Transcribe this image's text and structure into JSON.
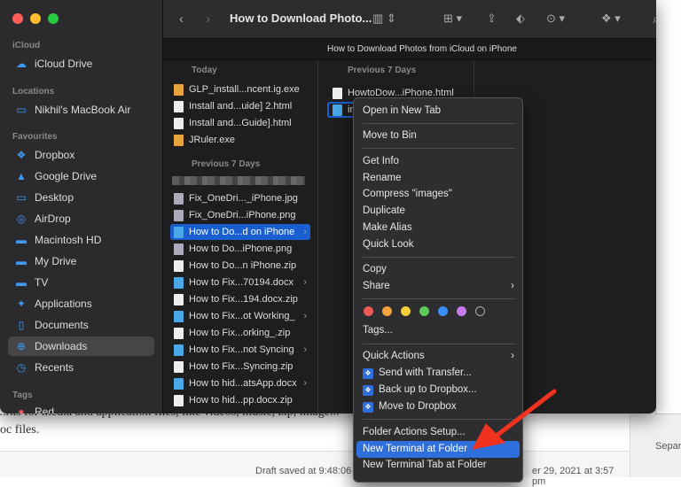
{
  "finder": {
    "title": "How to Download Photo...",
    "tab_title": "How to Download Photos from iCloud on iPhone",
    "sidebar": {
      "sections": [
        {
          "label": "iCloud",
          "items": [
            {
              "label": "iCloud Drive",
              "icon": "cloud-icon"
            }
          ]
        },
        {
          "label": "Locations",
          "items": [
            {
              "label": "Nikhil's MacBook Air",
              "icon": "laptop-icon"
            }
          ]
        },
        {
          "label": "Favourites",
          "items": [
            {
              "label": "Dropbox",
              "icon": "dropbox-icon"
            },
            {
              "label": "Google Drive",
              "icon": "google-drive-icon"
            },
            {
              "label": "Desktop",
              "icon": "desktop-icon"
            },
            {
              "label": "AirDrop",
              "icon": "airdrop-icon"
            },
            {
              "label": "Macintosh HD",
              "icon": "disk-icon"
            },
            {
              "label": "My Drive",
              "icon": "folder-icon"
            },
            {
              "label": "TV",
              "icon": "folder-icon"
            },
            {
              "label": "Applications",
              "icon": "applications-icon"
            },
            {
              "label": "Documents",
              "icon": "document-icon"
            },
            {
              "label": "Downloads",
              "icon": "download-icon",
              "selected": true
            },
            {
              "label": "Recents",
              "icon": "clock-icon"
            }
          ]
        },
        {
          "label": "Tags",
          "items": [
            {
              "label": "Red",
              "icon": "tag-red-icon"
            }
          ]
        }
      ]
    },
    "column1": {
      "today_header": "Today",
      "today": [
        "GLP_install...ncent.ig.exe",
        "Install and...uide] 2.html",
        "Install and...Guide].html",
        "JRuler.exe"
      ],
      "prev_header": "Previous 7 Days",
      "prev": [
        "Fix_OneDri..._iPhone.jpg",
        "Fix_OneDri...iPhone.png",
        "How to Do...d on iPhone",
        "How to Do...iPhone.png",
        "How to Do...n iPhone.zip",
        "How to Fix...70194.docx",
        "How to Fix...194.docx.zip",
        "How to Fix...ot Working_",
        "How to Fix...orking_.zip",
        "How to Fix...not Syncing",
        "How to Fix...Syncing.zip",
        "How to hid...atsApp.docx",
        "How to hid...pp.docx.zip"
      ]
    },
    "column2": {
      "header": "Previous 7 Days",
      "items": [
        "HowtoDow...iPhone.html",
        "images"
      ]
    }
  },
  "context_menu": {
    "items": [
      "Open in New Tab",
      "Move to Bin",
      "Get Info",
      "Rename",
      "Compress \"images\"",
      "Duplicate",
      "Make Alias",
      "Quick Look",
      "Copy",
      "Share",
      "Tags...",
      "Quick Actions",
      "Send with Transfer...",
      "Back up to Dropbox...",
      "Move to Dropbox",
      "Folder Actions Setup...",
      "New Terminal at Folder",
      "New Terminal Tab at Folder"
    ],
    "highlighted": "New Terminal at Folder",
    "tag_colors": [
      "#ec5b53",
      "#f5a33a",
      "#f6cf3a",
      "#5dcb5a",
      "#3b8ff5",
      "#c77bea",
      "#2e2e30"
    ]
  },
  "background_doc": {
    "line1": "...rks for media and application files, like videos, music, zip, image...                                        method does",
    "line2": "oc files.",
    "draft_status": "Draft saved at 9:48:06",
    "date": "er 29, 2021 at 3:57 pm",
    "side_label": "Separ"
  },
  "annotation": {
    "arrow_color": "#f0321e"
  }
}
